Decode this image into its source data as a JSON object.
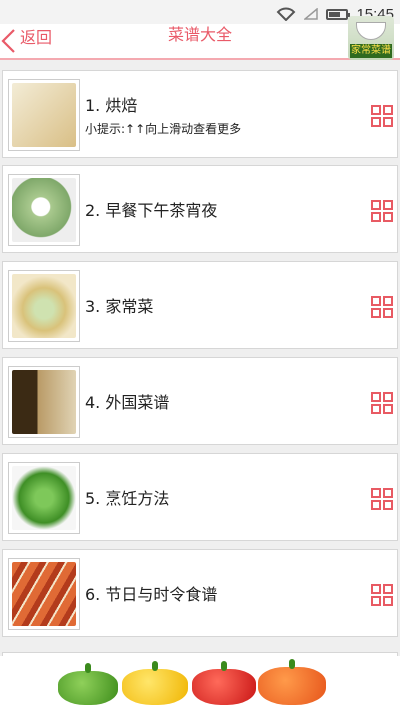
{
  "status": {
    "time": "15:45"
  },
  "header": {
    "back_label": "返回",
    "title": "菜谱大全",
    "logo_text": "家常菜谱"
  },
  "list": {
    "items": [
      {
        "label": "1. 烘焙",
        "hint": "小提示:↑↑向上滑动查看更多",
        "thumb_color": "#e8d9b5"
      },
      {
        "label": "2. 早餐下午茶宵夜",
        "thumb_color": "#a9c98e"
      },
      {
        "label": "3. 家常菜",
        "thumb_color": "#d9c27a"
      },
      {
        "label": "4. 外国菜谱",
        "thumb_color": "#8a6a3c"
      },
      {
        "label": "5. 烹饪方法",
        "thumb_color": "#5aa83a"
      },
      {
        "label": "6. 节日与时令食谱",
        "thumb_color": "#d8542c"
      }
    ]
  },
  "banner": {
    "peppers": [
      "green",
      "yellow",
      "red",
      "orange"
    ]
  },
  "colors": {
    "accent": "#e95a68"
  }
}
